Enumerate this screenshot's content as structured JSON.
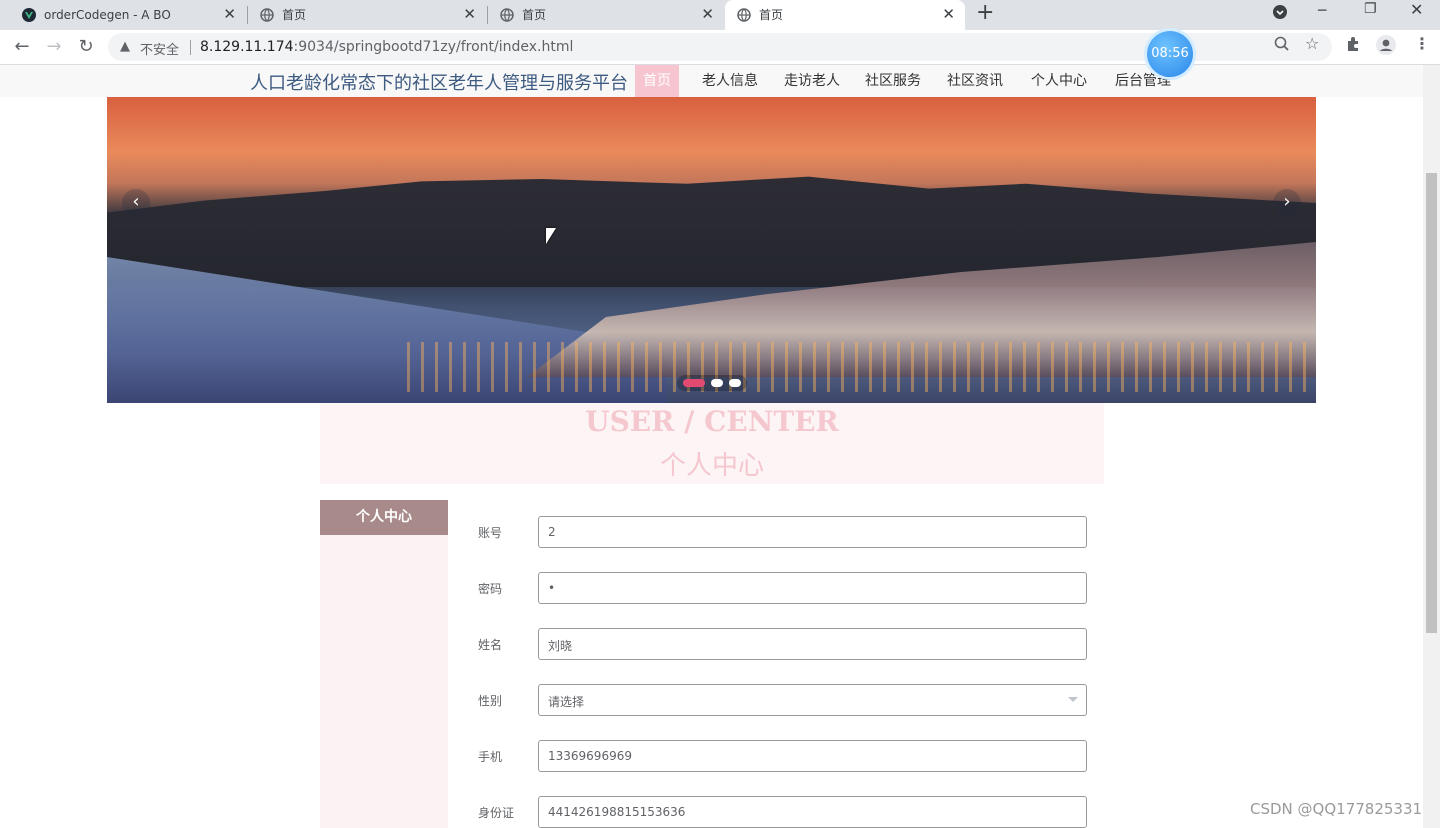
{
  "browser": {
    "tabs": [
      {
        "label": "orderCodegen - A BO",
        "icon": "vue-icon",
        "active": false
      },
      {
        "label": "首页",
        "icon": "globe-icon",
        "active": false
      },
      {
        "label": "首页",
        "icon": "globe-icon",
        "active": false
      },
      {
        "label": "首页",
        "icon": "globe-icon",
        "active": true
      }
    ],
    "new_tab": "+",
    "insecure_label": "不安全",
    "url_host": "8.129.11.174",
    "url_rest": ":9034/springbootd71zy/front/index.html",
    "clock": "08:56"
  },
  "site": {
    "title": "人口老龄化常态下的社区老年人管理与服务平台",
    "nav": [
      {
        "label": "首页",
        "active": true
      },
      {
        "label": "老人信息"
      },
      {
        "label": "走访老人"
      },
      {
        "label": "社区服务"
      },
      {
        "label": "社区资讯"
      },
      {
        "label": "个人中心"
      },
      {
        "label": "后台管理"
      }
    ]
  },
  "banner": {
    "prev": "‹",
    "next": "›",
    "slides": 3,
    "active_slide": 1
  },
  "section": {
    "en": "USER / CENTER",
    "cn": "个人中心"
  },
  "sidemenu": {
    "item": "个人中心"
  },
  "form": {
    "account_label": "账号",
    "account_value": "2",
    "password_label": "密码",
    "password_value": "•",
    "name_label": "姓名",
    "name_value": "刘晓",
    "gender_label": "性别",
    "gender_placeholder": "请选择",
    "phone_label": "手机",
    "phone_value": "13369696969",
    "idcard_label": "身份证",
    "idcard_value": "441426198815153636"
  },
  "watermark": "CSDN @QQ177825331",
  "colors": {
    "nav_active_bg": "#f7c5cf",
    "section_text": "#f5c7cf",
    "sidemenu_active": "#a88a8a",
    "title_color": "#3d5a80"
  }
}
